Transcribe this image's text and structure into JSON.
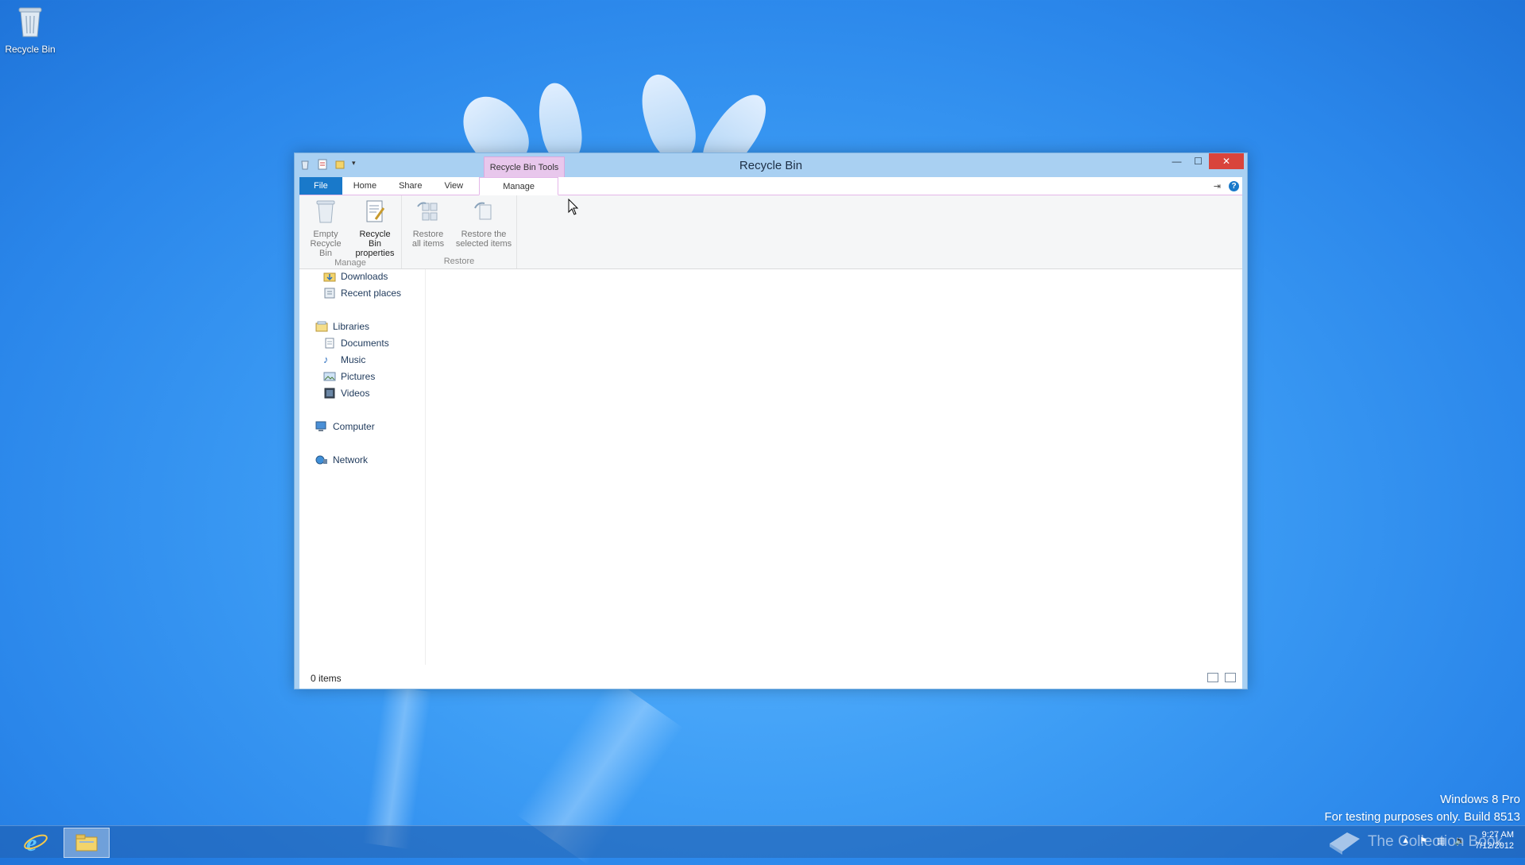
{
  "desktop": {
    "recycle_bin_label": "Recycle Bin"
  },
  "window": {
    "title": "Recycle Bin",
    "context_tab_label": "Recycle Bin Tools",
    "tabs": [
      {
        "label": "File"
      },
      {
        "label": "Home"
      },
      {
        "label": "Share"
      },
      {
        "label": "View"
      },
      {
        "label": "Manage"
      }
    ],
    "help_label": "?",
    "ribbon": {
      "groups": [
        {
          "label": "Manage",
          "commands": [
            {
              "line1": "Empty",
              "line2": "Recycle Bin"
            },
            {
              "line1": "Recycle Bin",
              "line2": "properties"
            }
          ]
        },
        {
          "label": "Restore",
          "commands": [
            {
              "line1": "Restore",
              "line2": "all items"
            },
            {
              "line1": "Restore the",
              "line2": "selected items"
            }
          ]
        }
      ]
    },
    "nav": {
      "items": [
        {
          "label": "Downloads"
        },
        {
          "label": "Recent places"
        },
        {
          "label": "Libraries"
        },
        {
          "label": "Documents"
        },
        {
          "label": "Music"
        },
        {
          "label": "Pictures"
        },
        {
          "label": "Videos"
        },
        {
          "label": "Computer"
        },
        {
          "label": "Network"
        }
      ]
    },
    "status": {
      "item_count": "0 items"
    }
  },
  "watermark": {
    "line1": "Windows 8 Pro",
    "line2": "For testing purposes only. Build 8513"
  },
  "overlay_logo": "The Collection Book",
  "tray": {
    "time": "9:27 AM",
    "date": "7/12/2012"
  },
  "colors": {
    "accent": "#1979ca",
    "context_tab": "#e8c7ec",
    "close_button": "#d9443b"
  }
}
